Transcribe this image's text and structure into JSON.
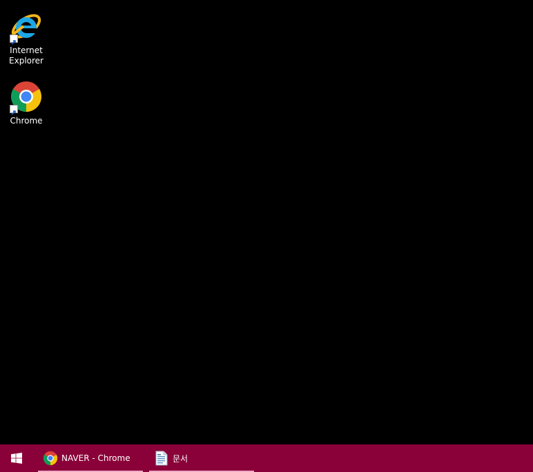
{
  "desktop": {
    "icons": [
      {
        "label": "Internet\nExplorer",
        "icon": "internet-explorer-icon"
      },
      {
        "label": "Chrome",
        "icon": "chrome-icon"
      }
    ]
  },
  "taskbar": {
    "color": "#8a0038",
    "underline_color": "#f2a9c6",
    "start_icon": "windows-start-icon",
    "items": [
      {
        "label": "NAVER - Chrome",
        "icon": "chrome-icon"
      },
      {
        "label": "문서",
        "icon": "document-icon"
      }
    ]
  }
}
